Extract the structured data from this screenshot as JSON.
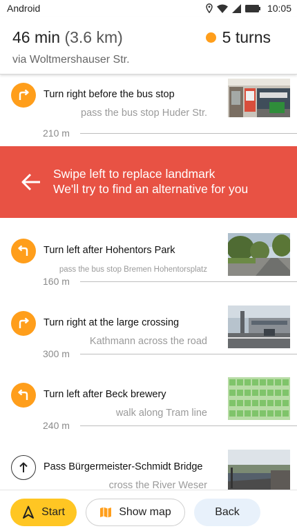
{
  "status_bar": {
    "carrier": "Android",
    "time": "10:05",
    "icons": [
      "location-icon",
      "wifi-icon",
      "signal-icon",
      "battery-icon"
    ]
  },
  "summary": {
    "duration": "46 min",
    "distance": "(3.6 km)",
    "via": "via Woltmershauser Str.",
    "turns": "5 turns",
    "turns_dot_color": "#ff9e1b"
  },
  "steps": [
    {
      "icon": "turn-right-icon",
      "title": "Turn right before the bus stop",
      "subtitle": "pass the bus stop Huder Str.",
      "distance": "210 m"
    },
    {
      "icon": "turn-left-icon",
      "title": "Turn left after Hohentors Park",
      "subtitle": "pass the bus stop Bremen Hohentorsplatz",
      "distance": "160 m"
    },
    {
      "icon": "turn-right-icon",
      "title": "Turn right at the large crossing",
      "subtitle": "Kathmann across the road",
      "distance": "300 m"
    },
    {
      "icon": "turn-left-icon",
      "title": "Turn left after Beck brewery",
      "subtitle": "walk along Tram line",
      "distance": "240 m"
    },
    {
      "icon": "straight-arrow-icon",
      "title": "Pass Bürgermeister-Schmidt Bridge",
      "subtitle": "cross the River Weser"
    }
  ],
  "swipe_banner": {
    "line1": "Swipe left to replace landmark",
    "line2": "We'll try to find an alternative for you",
    "color": "#e85244"
  },
  "buttons": {
    "start": "Start",
    "show_map": "Show map",
    "back": "Back"
  },
  "colors": {
    "accent_orange": "#ff9e1b",
    "start_yellow": "#ffc623",
    "back_blue": "#e8f1fb"
  }
}
